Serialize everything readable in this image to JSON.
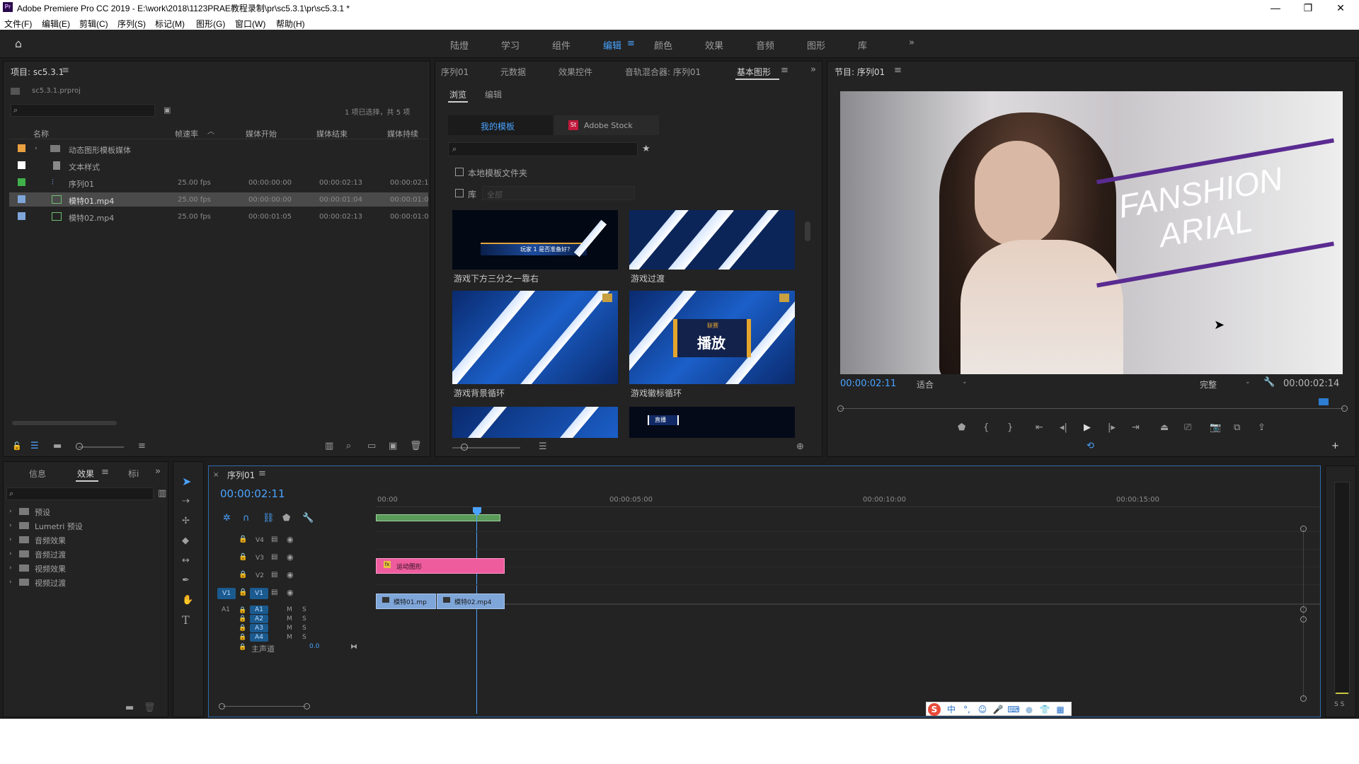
{
  "window": {
    "title": "Adobe Premiere Pro CC 2019 - E:\\work\\2018\\1123PRAE教程录制\\pr\\sc5.3.1\\pr\\sc5.3.1 *",
    "app_icon": "Pr",
    "minimize": "—",
    "restore": "❐",
    "close": "✕"
  },
  "menu": [
    "文件(F)",
    "编辑(E)",
    "剪辑(C)",
    "序列(S)",
    "标记(M)",
    "图形(G)",
    "窗口(W)",
    "帮助(H)"
  ],
  "workspaces": [
    "陆燈",
    "学习",
    "组件",
    "编辑",
    "颜色",
    "效果",
    "音频",
    "图形",
    "库"
  ],
  "project_panel": {
    "tab": "项目: sc5.3.1",
    "file": "sc5.3.1.prproj",
    "selection_info": "1 项已选择，共 5 项",
    "columns": [
      "名称",
      "帧速率",
      "媒体开始",
      "媒体结束",
      "媒体持续"
    ],
    "items": [
      {
        "name": "动态图形模板媒体",
        "fps": "",
        "start": "",
        "end": "",
        "dur": "",
        "color": "#e8a040"
      },
      {
        "name": "文本样式",
        "fps": "",
        "start": "",
        "end": "",
        "dur": "",
        "color": "#ffffff"
      },
      {
        "name": "序列01",
        "fps": "25.00 fps",
        "start": "00:00:00:00",
        "end": "00:00:02:13",
        "dur": "00:00:02:1",
        "color": "#3fb04a"
      },
      {
        "name": "模特01.mp4",
        "fps": "25.00 fps",
        "start": "00:00:00:00",
        "end": "00:00:01:04",
        "dur": "00:00:01:0",
        "color": "#7fa6d9"
      },
      {
        "name": "模特02.mp4",
        "fps": "25.00 fps",
        "start": "00:00:01:05",
        "end": "00:00:02:13",
        "dur": "00:00:01:0",
        "color": "#7fa6d9"
      }
    ]
  },
  "center_panel": {
    "tabs": [
      "序列01",
      "元数据",
      "效果控件",
      "音轨混合器: 序列01",
      "基本图形"
    ],
    "sub_tabs": [
      "浏览",
      "编辑"
    ],
    "source_tabs": [
      "我的模板",
      "Adobe Stock"
    ],
    "checkbox_local": "本地模板文件夹",
    "checkbox_lib": "库",
    "lib_select": "全部",
    "templates": [
      {
        "label": "游戏下方三分之一靠右",
        "text": "玩家 1 是否准备好?"
      },
      {
        "label": "游戏过渡",
        "text": ""
      },
      {
        "label": "游戏背景循环",
        "text": ""
      },
      {
        "label": "游戏徽标循环",
        "text": "播放",
        "small": "联赛"
      },
      {
        "label": "",
        "text": ""
      },
      {
        "label": "",
        "text": "直播"
      }
    ]
  },
  "program_monitor": {
    "tab": "节目: 序列01",
    "overlay_line1": "FANSHION",
    "overlay_line2": "ARIAL",
    "timecode": "00:00:02:11",
    "fit": "适合",
    "quality": "完整",
    "duration": "00:00:02:14"
  },
  "effects_panel": {
    "tabs": [
      "信息",
      "效果",
      "标i"
    ],
    "folders": [
      "预设",
      "Lumetri 预设",
      "音频效果",
      "音频过渡",
      "视频效果",
      "视频过渡"
    ]
  },
  "timeline": {
    "tab": "序列01",
    "timecode": "00:00:02:11",
    "ruler": [
      "00:00",
      "00:00:05:00",
      "00:00:10:00",
      "00:00:15:00"
    ],
    "video_tracks": [
      "V4",
      "V3",
      "V2",
      "V1"
    ],
    "audio_tracks": [
      "A1",
      "A2",
      "A3",
      "A4"
    ],
    "source_v": "V1",
    "source_a": "A1",
    "master": "主声道",
    "master_value": "0.0",
    "clips": {
      "graphic": "运动图形",
      "video1": "模特01.mp",
      "video2": "模特02.mp4"
    }
  },
  "audio_meter": {
    "labels": "S S"
  },
  "ime": [
    "S",
    "中",
    "°,",
    "☺",
    "🎤",
    "⌨",
    "👕",
    "▦"
  ]
}
